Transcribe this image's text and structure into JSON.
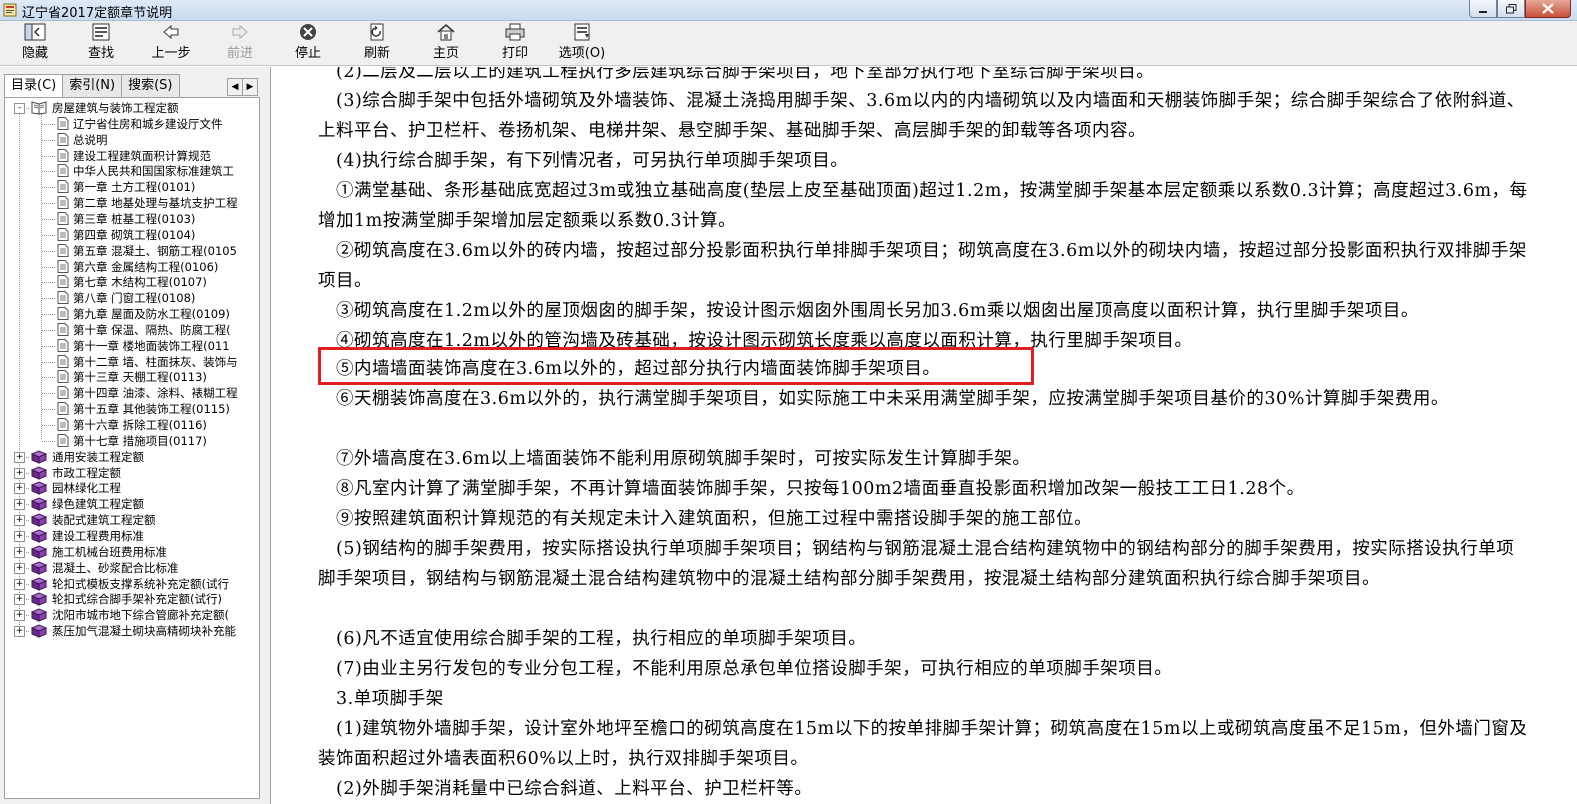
{
  "window": {
    "title": "辽宁省2017定额章节说明"
  },
  "toolbar": {
    "buttons": [
      {
        "label": "隐藏",
        "icon": "hide-icon"
      },
      {
        "label": "查找",
        "icon": "find-icon"
      },
      {
        "label": "上一步",
        "icon": "back-icon"
      },
      {
        "label": "前进",
        "icon": "forward-icon",
        "disabled": true
      },
      {
        "label": "停止",
        "icon": "stop-icon"
      },
      {
        "label": "刷新",
        "icon": "refresh-icon"
      },
      {
        "label": "主页",
        "icon": "home-icon"
      },
      {
        "label": "打印",
        "icon": "print-icon"
      },
      {
        "label": "选项(O)",
        "icon": "options-icon"
      }
    ]
  },
  "sidebar": {
    "tabs": [
      {
        "label": "目录(C)",
        "active": true
      },
      {
        "label": "索引(N)"
      },
      {
        "label": "搜索(S)"
      }
    ],
    "tree": {
      "root": "房屋建筑与装饰工程定额",
      "children": [
        "辽宁省住房和城乡建设厅文件",
        "总说明",
        "建设工程建筑面积计算规范",
        "中华人民共和国国家标准建筑工",
        "第一章 土方工程(0101)",
        "第二章 地基处理与基坑支护工程",
        "第三章 桩基工程(0103)",
        "第四章 砌筑工程(0104)",
        "第五章 混凝土、钢筋工程(0105",
        "第六章 金属结构工程(0106)",
        "第七章 木结构工程(0107)",
        "第八章 门窗工程(0108)",
        "第九章 屋面及防水工程(0109)",
        "第十章 保温、隔热、防腐工程(",
        "第十一章 楼地面装饰工程(011",
        "第十二章 墙、柱面抹灰、装饰与",
        "第十三章 天棚工程(0113)",
        "第十四章 油漆、涂料、裱糊工程",
        "第十五章 其他装饰工程(0115)",
        "第十六章 拆除工程(0116)",
        "第十七章 措施项目(0117)"
      ],
      "books": [
        "通用安装工程定额",
        "市政工程定额",
        "园林绿化工程",
        "绿色建筑工程定额",
        "装配式建筑工程定额",
        "建设工程费用标准",
        "施工机械台班费用标准",
        "混凝土、砂浆配合比标准",
        "轮扣式模板支撑系统补充定额(试行",
        "轮扣式综合脚手架补充定额(试行)",
        "沈阳市城市地下综合管廊补充定额(",
        "蒸压加气混凝土砌块高精砌块补充能"
      ]
    }
  },
  "content": {
    "paragraphs": [
      "(2)二层及二层以上的建筑工程执行多层建筑综合脚手架项目，地下室部分执行地下室综合脚手架项目。",
      "(3)综合脚手架中包括外墙砌筑及外墙装饰、混凝土浇捣用脚手架、3.6m以内的内墙砌筑以及内墙面和天棚装饰脚手架；综合脚手架综合了依附斜道、上料平台、护卫栏杆、卷扬机架、电梯井架、悬空脚手架、基础脚手架、高层脚手架的卸载等各项内容。",
      "(4)执行综合脚手架，有下列情况者，可另执行单项脚手架项目。",
      "①满堂基础、条形基础底宽超过3m或独立基础高度(垫层上皮至基础顶面)超过1.2m，按满堂脚手架基本层定额乘以系数0.3计算；高度超过3.6m，每增加1m按满堂脚手架增加层定额乘以系数0.3计算。",
      "②砌筑高度在3.6m以外的砖内墙，按超过部分投影面积执行单排脚手架项目；砌筑高度在3.6m以外的砌块内墙，按超过部分投影面积执行双排脚手架项目。",
      "③砌筑高度在1.2m以外的屋顶烟囱的脚手架，按设计图示烟囱外围周长另加3.6m乘以烟囱出屋顶高度以面积计算，执行里脚手架项目。",
      "④砌筑高度在1.2m以外的管沟墙及砖基础，按设计图示砌筑长度乘以高度以面积计算，执行里脚手架项目。",
      "⑤内墙墙面装饰高度在3.6m以外的，超过部分执行内墙面装饰脚手架项目。",
      "⑥天棚装饰高度在3.6m以外的，执行满堂脚手架项目，如实际施工中未采用满堂脚手架，应按满堂脚手架项目基价的30%计算脚手架费用。",
      "⑦外墙高度在3.6m以上墙面装饰不能利用原砌筑脚手架时，可按实际发生计算脚手架。",
      "⑧凡室内计算了满堂脚手架，不再计算墙面装饰脚手架，只按每100m2墙面垂直投影面积增加改架一般技工工日1.28个。",
      "⑨按照建筑面积计算规范的有关规定未计入建筑面积，但施工过程中需搭设脚手架的施工部位。",
      "(5)钢结构的脚手架费用，按实际搭设执行单项脚手架项目；钢结构与钢筋混凝土混合结构建筑物中的钢结构部分的脚手架费用，按实际搭设执行单项脚手架项目，钢结构与钢筋混凝土混合结构建筑物中的混凝土结构部分脚手架费用，按混凝土结构部分建筑面积执行综合脚手架项目。",
      "(6)凡不适宜使用综合脚手架的工程，执行相应的单项脚手架项目。",
      "(7)由业主另行发包的专业分包工程，不能利用原总承包单位搭设脚手架，可执行相应的单项脚手架项目。",
      "3.单项脚手架",
      "(1)建筑物外墙脚手架，设计室外地坪至檐口的砌筑高度在15m以下的按单排脚手架计算；砌筑高度在15m以上或砌筑高度虽不足15m，但外墙门窗及装饰面积超过外墙表面积60%以上时，执行双排脚手架项目。",
      "(2)外脚手架消耗量中已综合斜道、上料平台、护卫栏杆等。"
    ],
    "highlight_color": "#e02020"
  }
}
